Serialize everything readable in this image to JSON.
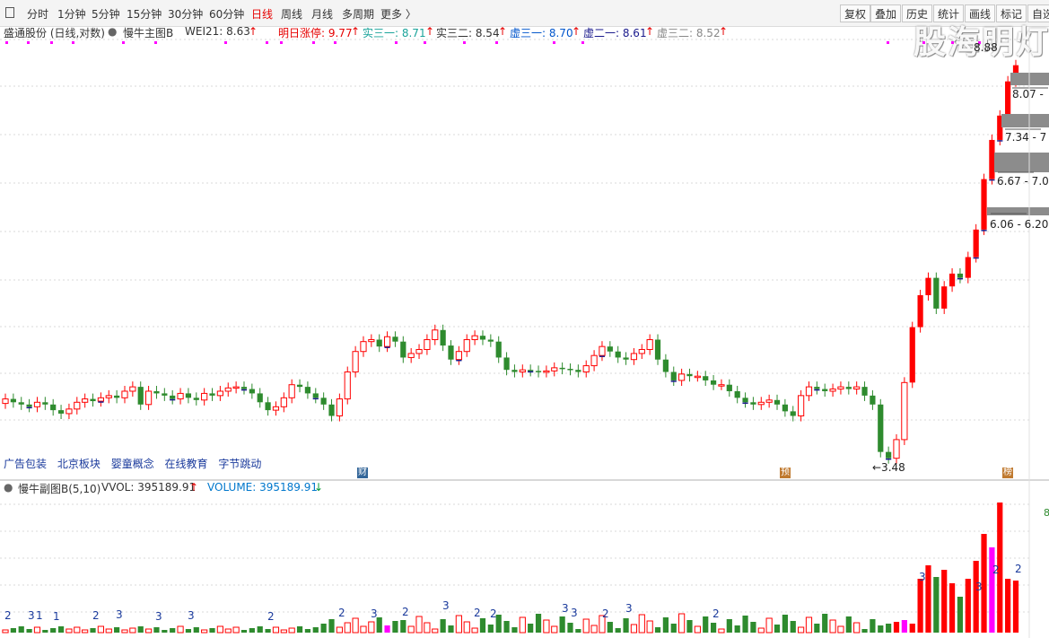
{
  "toolbar": {
    "periods": [
      "分时",
      "1分钟",
      "5分钟",
      "15分钟",
      "30分钟",
      "60分钟",
      "日线",
      "周线",
      "月线",
      "多周期",
      "更多 〉"
    ],
    "active_period": "日线",
    "buttons": [
      "复权",
      "叠加",
      "历史",
      "统计",
      "画线",
      "标记",
      "自选"
    ]
  },
  "watermark": "股海明灯",
  "main_info": {
    "stock": "盛通股份 (日线,对数)",
    "indicator": "慢牛主图B",
    "wei21": "WEI21: 8.63",
    "limit_up": "明日涨停: 9.77",
    "shi1": "实三一: 8.71",
    "shi2": "实三二: 8.54",
    "xu31": "虚三一: 8.70",
    "xu21": "虚二一: 8.61",
    "xu32": "虚三二: 8.52",
    "arrow": "↑"
  },
  "price_labels": [
    "8.88",
    "8.07 -",
    "7.34 - 7",
    "6.67 - 7.0",
    "6.06 - 6.20"
  ],
  "low_label": "←3.48",
  "concepts": [
    "广告包装",
    "北京板块",
    "婴童概念",
    "在线教育",
    "字节跳动"
  ],
  "event_markers": [
    "财",
    "预",
    "榜"
  ],
  "sub_info": {
    "indicator": "慢牛副图B(5,10)",
    "vvol": "VVOL: 395189.91",
    "volume": "VOLUME: 395189.91",
    "up_arrow": "↑",
    "down_arrow": "↓"
  },
  "right_tag": "8",
  "vol_counts": [
    "2",
    "3",
    "1",
    "1",
    "2",
    "3",
    "3",
    "3",
    "2",
    "2",
    "3",
    "2",
    "3",
    "2",
    "2",
    "3",
    "3",
    "2",
    "3",
    "2",
    "3",
    "3",
    "2",
    "2"
  ],
  "colors": {
    "up": "#ff0000",
    "down": "#2e8b2e",
    "magenta": "#ff00ff",
    "count_text": "#1a3a9c",
    "xu": "#0055cc",
    "shi1": "#1aa39a"
  },
  "chart_data": {
    "type": "candlestick",
    "scale": "log",
    "title": "盛通股份 (日线,对数)",
    "labels_shown": [
      "8.88",
      "8.07",
      "7.34",
      "6.67",
      "6.06",
      "3.48"
    ],
    "close_series": [
      4.05,
      4.02,
      4.0,
      3.98,
      4.02,
      4.0,
      3.95,
      3.92,
      3.96,
      4.02,
      4.05,
      4.03,
      4.06,
      4.08,
      4.06,
      4.12,
      4.16,
      4.0,
      4.12,
      4.1,
      4.08,
      4.05,
      4.1,
      4.06,
      4.04,
      4.1,
      4.08,
      4.12,
      4.15,
      4.16,
      4.14,
      4.1,
      4.02,
      3.95,
      3.98,
      4.06,
      4.18,
      4.16,
      4.1,
      4.06,
      4.0,
      3.9,
      4.05,
      4.3,
      4.5,
      4.6,
      4.62,
      4.55,
      4.65,
      4.6,
      4.44,
      4.48,
      4.52,
      4.62,
      4.72,
      4.56,
      4.42,
      4.5,
      4.62,
      4.66,
      4.62,
      4.6,
      4.44,
      4.32,
      4.3,
      4.32,
      4.31,
      4.3,
      4.31,
      4.34,
      4.33,
      4.32,
      4.3,
      4.36,
      4.46,
      4.55,
      4.5,
      4.44,
      4.42,
      4.48,
      4.52,
      4.62,
      4.42,
      4.3,
      4.22,
      4.28,
      4.26,
      4.26,
      4.22,
      4.18,
      4.18,
      4.12,
      4.06,
      4.02,
      4.0,
      4.02,
      4.04,
      4.0,
      3.94,
      3.9,
      4.08,
      4.16,
      4.14,
      4.12,
      4.14,
      4.16,
      4.14,
      4.16,
      4.08,
      4.0,
      3.6,
      3.55,
      3.7,
      4.2,
      4.75,
      5.1,
      5.3,
      4.95,
      5.2,
      5.35,
      5.3,
      5.55,
      5.9,
      6.6,
      7.2,
      7.6,
      8.2,
      8.5
    ]
  }
}
